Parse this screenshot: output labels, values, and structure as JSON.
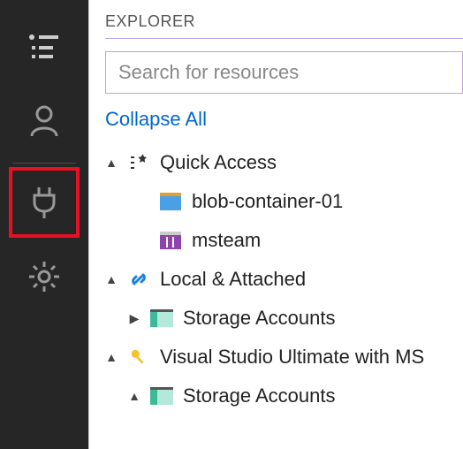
{
  "activity": {
    "items": [
      {
        "name": "explorer",
        "icon": "list"
      },
      {
        "name": "account",
        "icon": "person"
      },
      {
        "name": "connect",
        "icon": "plug",
        "selected": true
      },
      {
        "name": "settings",
        "icon": "gear"
      }
    ]
  },
  "panel": {
    "title": "EXPLORER",
    "search_placeholder": "Search for resources",
    "collapse_label": "Collapse All"
  },
  "tree": {
    "quick_access": {
      "label": "Quick Access",
      "items": [
        {
          "label": "blob-container-01",
          "icon": "blob"
        },
        {
          "label": "msteam",
          "icon": "table"
        }
      ]
    },
    "local_attached": {
      "label": "Local & Attached",
      "storage_label": "Storage Accounts"
    },
    "subscription": {
      "label": "Visual Studio Ultimate with MS",
      "storage_label": "Storage Accounts"
    }
  }
}
